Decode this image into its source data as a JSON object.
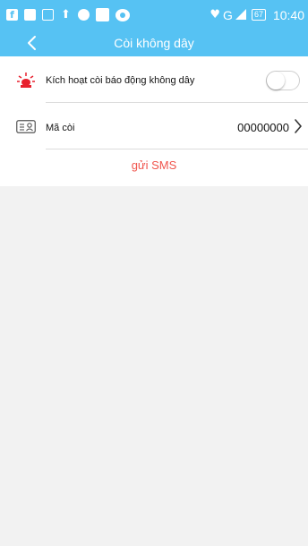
{
  "status_bar": {
    "icons": [
      "facebook-icon",
      "zalo-icon",
      "image-icon",
      "upload-icon",
      "sync-icon",
      "square-icon",
      "eye-icon"
    ],
    "network": "G",
    "battery": "67",
    "time": "10:40"
  },
  "header": {
    "title": "Còi không dây",
    "back_icon": "chevron-left-icon"
  },
  "settings": {
    "enable_alarm": {
      "label": "Kích hoạt còi báo động không dây",
      "icon": "siren-icon",
      "enabled": false
    },
    "siren_code": {
      "label": "Mã còi",
      "icon": "id-card-icon",
      "value": "00000000"
    }
  },
  "send_sms_label": "gửi SMS",
  "colors": {
    "header": "#56c2f3",
    "accent_text": "#f0554d",
    "alarm_icon": "#e8212e",
    "background": "#f2f2f2"
  }
}
